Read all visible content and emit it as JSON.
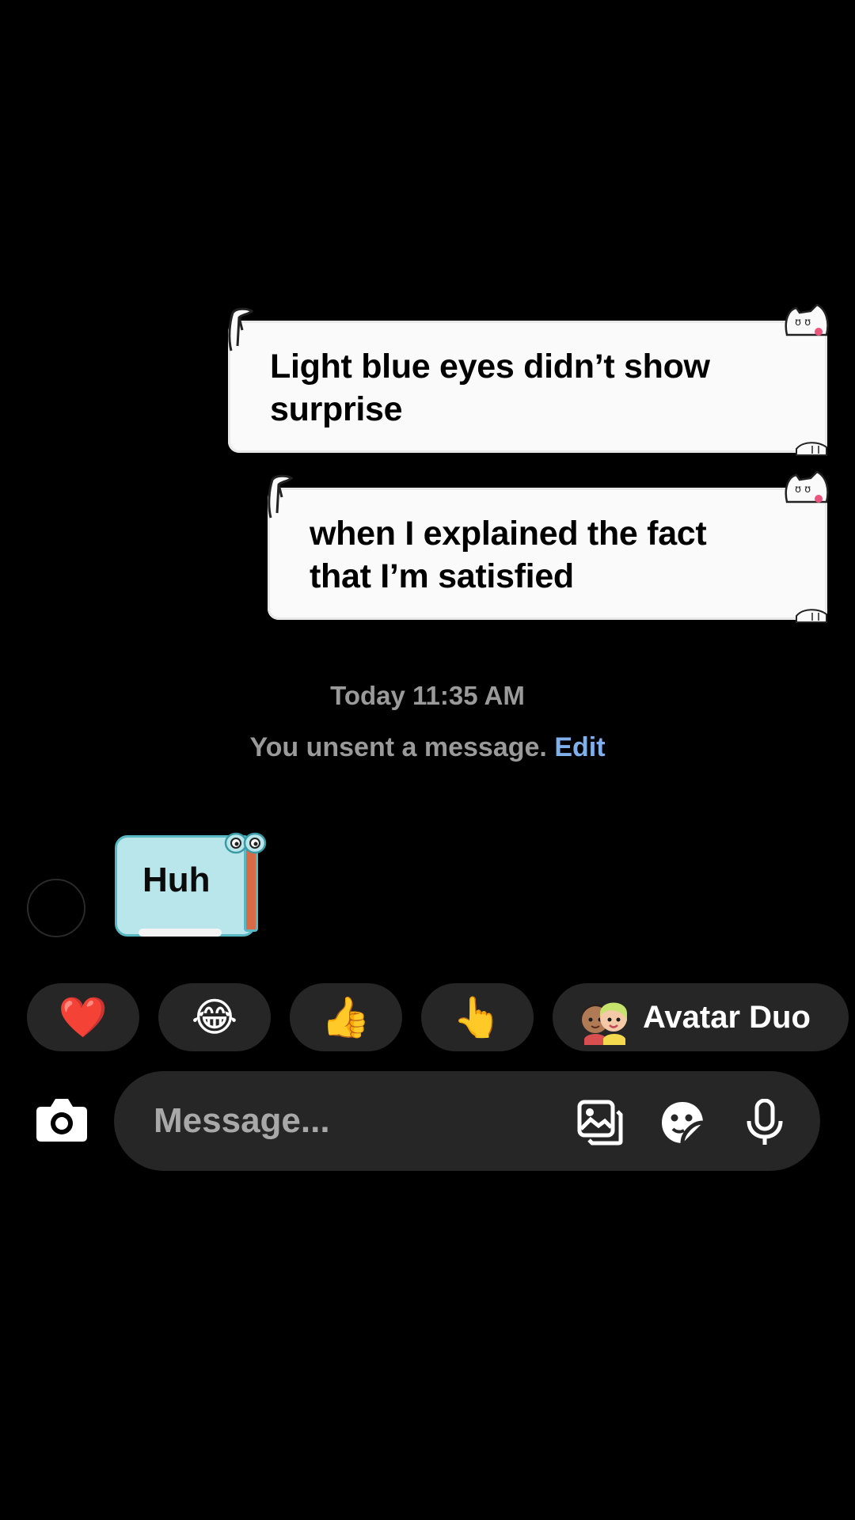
{
  "conversation": {
    "messages": [
      {
        "direction": "sent",
        "lines": [
          "Light blue eyes didn’t show",
          "surprise"
        ]
      },
      {
        "direction": "sent",
        "lines": [
          "when I explained the fact",
          "that I’m satisfied"
        ]
      },
      {
        "direction": "received",
        "text": "Huh"
      }
    ],
    "timestamp": "Today 11:35 AM",
    "unsent_notice": {
      "text": "You unsent a message.",
      "action": "Edit"
    }
  },
  "quick_reactions": {
    "heart": "❤️",
    "laugh": "😂",
    "thumbs_up": "👍",
    "pointing": "👆",
    "avatar_duo_label": "Avatar Duo"
  },
  "composer": {
    "placeholder": "Message...",
    "icons": [
      "camera-icon",
      "gallery-icon",
      "sticker-icon",
      "microphone-icon"
    ]
  },
  "colors": {
    "background": "#000000",
    "sent_bubble": "#fafafa",
    "received_bubble": "#b9e6ea",
    "pill": "#262626",
    "muted_text": "#9a9a9a",
    "link": "#7fb0ec"
  }
}
